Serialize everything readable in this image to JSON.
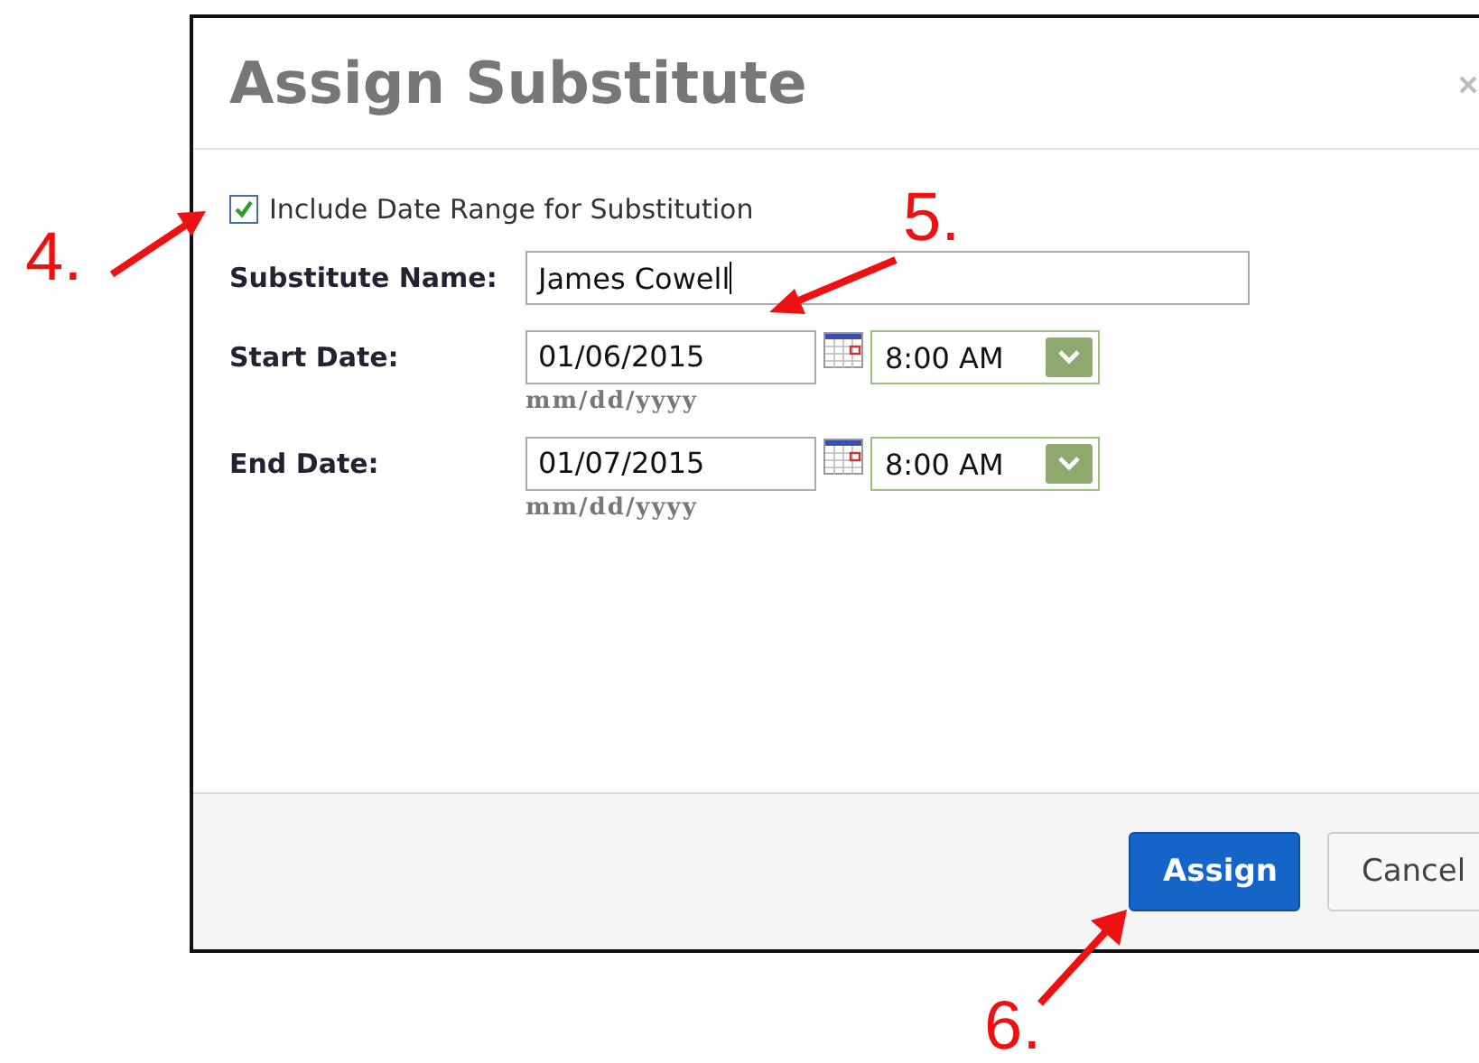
{
  "dialog": {
    "title": "Assign Substitute",
    "include_range": {
      "label": "Include Date Range for Substitution",
      "checked": true
    },
    "substitute_name": {
      "label": "Substitute Name:",
      "value": "James Cowell"
    },
    "dates": [
      {
        "label": "Start Date:",
        "value": "01/06/2015",
        "hint": "mm/dd/yyyy",
        "time": "8:00 AM"
      },
      {
        "label": "End Date:",
        "value": "01/07/2015",
        "hint": "mm/dd/yyyy",
        "time": "8:00 AM"
      }
    ],
    "buttons": [
      {
        "label": "Assign",
        "kind": "primary"
      },
      {
        "label": "Cancel",
        "kind": "secondary"
      }
    ]
  },
  "annotations": [
    {
      "label": "4."
    },
    {
      "label": "5."
    },
    {
      "label": "6."
    }
  ]
}
